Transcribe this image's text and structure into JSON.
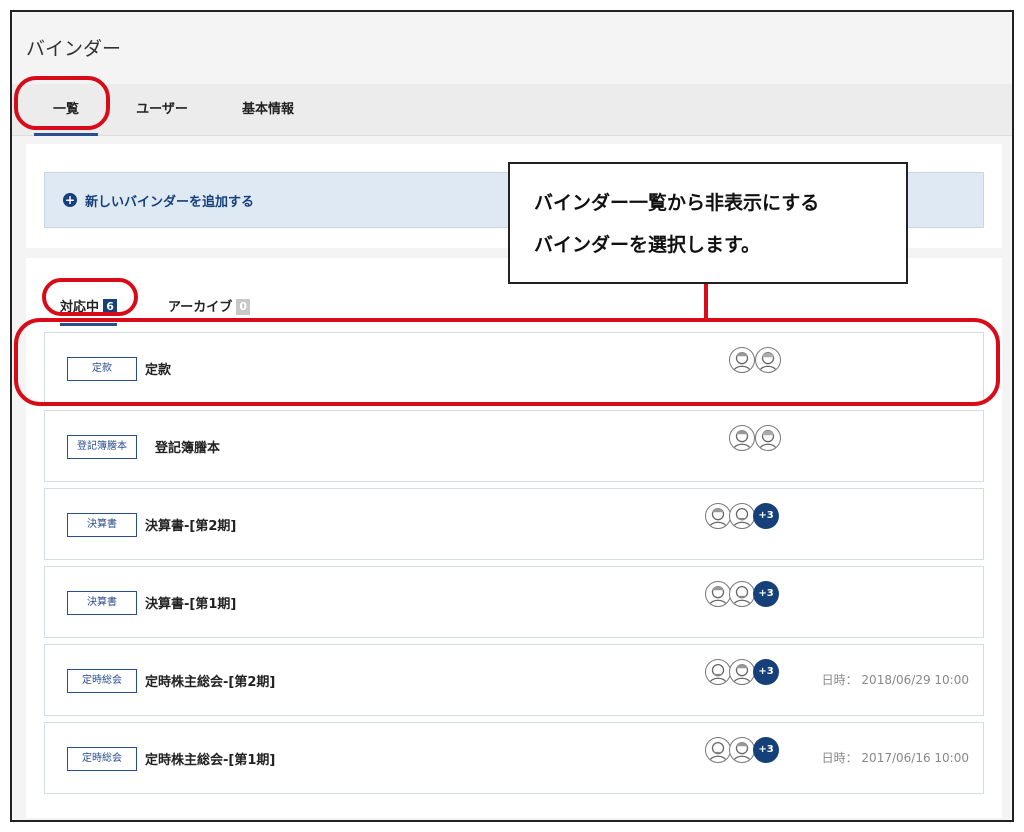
{
  "page": {
    "title": "バインダー"
  },
  "tabs": [
    {
      "label": "一覧"
    },
    {
      "label": "ユーザー"
    },
    {
      "label": "基本情報"
    }
  ],
  "add_binder": {
    "icon": "plus-circle-icon",
    "label": "新しいバインダーを追加する"
  },
  "subtabs": [
    {
      "label": "対応中",
      "count": "6"
    },
    {
      "label": "アーカイブ",
      "count": "0"
    }
  ],
  "binders": [
    {
      "tag": "定款",
      "name": "定款",
      "extra": "",
      "date": ""
    },
    {
      "tag": "登記簿謄本",
      "name": "登記簿謄本",
      "extra": "",
      "date": ""
    },
    {
      "tag": "決算書",
      "name": "決算書-[第2期]",
      "extra": "+3",
      "date": ""
    },
    {
      "tag": "決算書",
      "name": "決算書-[第1期]",
      "extra": "+3",
      "date": ""
    },
    {
      "tag": "定時総会",
      "name": "定時株主総会-[第2期]",
      "extra": "+3",
      "date": "日時： 2018/06/29 10:00"
    },
    {
      "tag": "定時総会",
      "name": "定時株主総会-[第1期]",
      "extra": "+3",
      "date": "日時： 2017/06/16 10:00"
    }
  ],
  "callout": {
    "line1": "バインダー一覧から非表示にする",
    "line2": "バインダーを選択します。"
  },
  "colors": {
    "accent": "#16407a",
    "highlight": "#d80c18",
    "add_bg": "#dfe9f3"
  }
}
